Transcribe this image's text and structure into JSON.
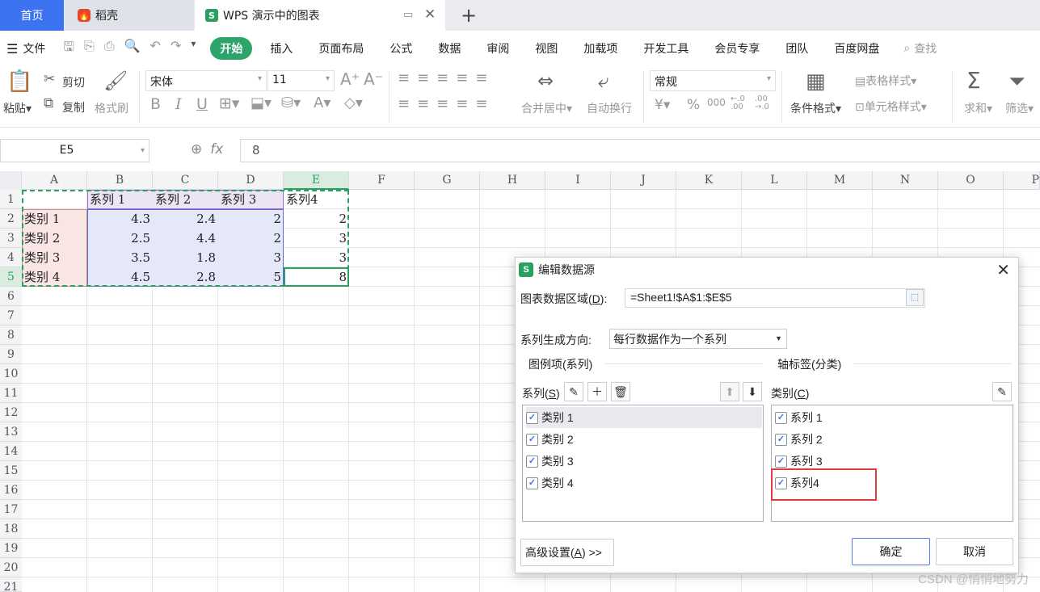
{
  "tabs": {
    "home": "首页",
    "daoke": "稻壳",
    "doc": "WPS 演示中的图表",
    "add": "+"
  },
  "menu": {
    "file": "文件",
    "start": "开始",
    "items": [
      "插入",
      "页面布局",
      "公式",
      "数据",
      "审阅",
      "视图",
      "加载项",
      "开发工具",
      "会员专享",
      "团队",
      "百度网盘"
    ],
    "search": "查找"
  },
  "ribbon": {
    "paste": "粘贴",
    "cut": "剪切",
    "copy": "复制",
    "format_painter": "格式刷",
    "font": "宋体",
    "font_size": "11",
    "bold": "B",
    "italic": "I",
    "underline": "U",
    "merge_center": "合并居中",
    "wrap_text": "自动换行",
    "number_format": "常规",
    "currency": "¥",
    "percent": "%",
    "thousands": "000",
    "inc_decimal": "←.0 .00",
    "dec_decimal": ".00 →.0",
    "cond_format": "条件格式",
    "table_style": "表格样式",
    "cell_style": "单元格样式",
    "sum": "求和",
    "filter": "筛选"
  },
  "formula_bar": {
    "name_box": "E5",
    "fx": "fx",
    "value": "8"
  },
  "sheet": {
    "columns": [
      "A",
      "B",
      "C",
      "D",
      "E",
      "F",
      "G",
      "H",
      "I",
      "J",
      "K",
      "L",
      "M",
      "N",
      "O",
      "P"
    ],
    "rows": [
      "1",
      "2",
      "3",
      "4",
      "5",
      "6",
      "7",
      "8",
      "9",
      "10",
      "11",
      "12",
      "13",
      "14",
      "15",
      "16",
      "17",
      "18",
      "19",
      "20",
      "21"
    ],
    "cells": {
      "B1": "系列 1",
      "C1": "系列 2",
      "D1": "系列 3",
      "E1": "系列4",
      "A2": "类别 1",
      "B2": "4.3",
      "C2": "2.4",
      "D2": "2",
      "E2": "2",
      "A3": "类别 2",
      "B3": "2.5",
      "C3": "4.4",
      "D3": "2",
      "E3": "3",
      "A4": "类别 3",
      "B4": "3.5",
      "C4": "1.8",
      "D4": "3",
      "E4": "3",
      "A5": "类别 4",
      "B5": "4.5",
      "C5": "2.8",
      "D5": "5",
      "E5": "8"
    }
  },
  "dialog": {
    "title": "编辑数据源",
    "range_label": "图表数据区域(D):",
    "range_label_pre": "图表数据区域(",
    "range_label_key": "D",
    "range_label_post": "):",
    "range_value": "=Sheet1!$A$1:$E$5",
    "direction_label": "系列生成方向:",
    "direction_value": "每行数据作为一个系列",
    "legend_group": "图例项(系列)",
    "series_label_pre": "系列(",
    "series_label_key": "S",
    "series_label_post": ")",
    "axis_group": "轴标签(分类)",
    "category_label_pre": "类别(",
    "category_label_key": "C",
    "category_label_post": ")",
    "legend_items": [
      {
        "label": "类别 1",
        "checked": true
      },
      {
        "label": "类别 2",
        "checked": true
      },
      {
        "label": "类别 3",
        "checked": true
      },
      {
        "label": "类别 4",
        "checked": true
      }
    ],
    "axis_items": [
      {
        "label": "系列 1",
        "checked": true
      },
      {
        "label": "系列 2",
        "checked": true
      },
      {
        "label": "系列 3",
        "checked": true
      },
      {
        "label": "系列4",
        "checked": true
      }
    ],
    "advanced_pre": "高级设置(",
    "advanced_key": "A",
    "advanced_post": ") >>",
    "ok": "确定",
    "cancel": "取消"
  },
  "watermark": "CSDN @悄悄地努力",
  "colors": {
    "accent_green": "#2a9f62",
    "tab_blue": "#3b73f0",
    "highlight_red": "#e03c3c"
  }
}
